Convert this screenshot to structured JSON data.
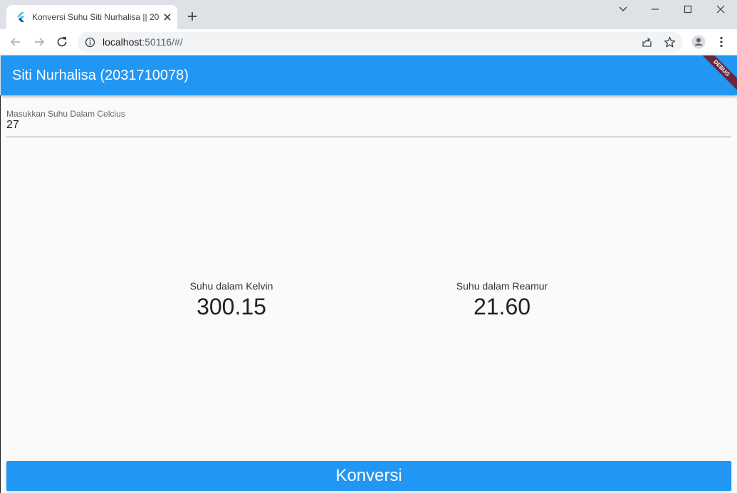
{
  "browser": {
    "tab_title": "Konversi Suhu Siti Nurhalisa || 20",
    "url_host": "localhost",
    "url_path": ":50116/#/"
  },
  "app": {
    "title": "Siti Nurhalisa (2031710078)",
    "debug_label": "DEBUG",
    "accent_color": "#2196f3"
  },
  "input": {
    "label": "Masukkan Suhu Dalam Celcius",
    "value": "27"
  },
  "results": {
    "kelvin_label": "Suhu dalam Kelvin",
    "kelvin_value": "300.15",
    "reamur_label": "Suhu dalam Reamur",
    "reamur_value": "21.60"
  },
  "button": {
    "label": "Konversi"
  }
}
